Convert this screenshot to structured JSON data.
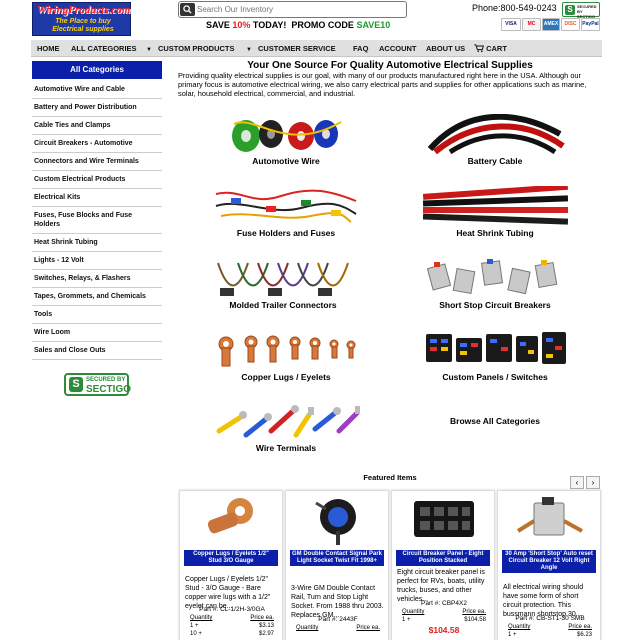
{
  "header": {
    "logo_title": "WiringProducts.com",
    "logo_tagline": "The Place to buy Electrical supplies",
    "search_placeholder": "Search Our Inventory",
    "promo": {
      "save": "SAVE",
      "percent": "10%",
      "today": "TODAY!",
      "code_label": "PROMO CODE",
      "code": "SAVE10"
    },
    "phone_label": "Phone:",
    "phone": "800-549-0243",
    "seal_small": "SECURED BY SECTIGO",
    "cards": [
      "VISA",
      "MC",
      "AMEX",
      "DISC",
      "PayPal"
    ]
  },
  "nav": {
    "items": [
      "HOME",
      "ALL CATEGORIES",
      "CUSTOM PRODUCTS",
      "CUSTOMER SERVICE",
      "FAQ",
      "ACCOUNT",
      "ABOUT US",
      "CART"
    ]
  },
  "sidebar": {
    "heading": "All Categories",
    "items": [
      "Automotive Wire and Cable",
      "Battery and Power Distribution",
      "Cable Ties and Clamps",
      "Circuit Breakers - Automotive",
      "Connectors and Wire Terminals",
      "Custom Electrical Products",
      "Electrical Kits",
      "Fuses, Fuse Blocks and Fuse Holders",
      "Heat Shrink Tubing",
      "Lights - 12 Volt",
      "Switches, Relays, & Flashers",
      "Tapes, Grommets, and Chemicals",
      "Tools",
      "Wire Loom",
      "Sales and Close Outs"
    ],
    "secured_top": "SECURED BY",
    "secured_brand": "SECTIGO"
  },
  "main": {
    "title": "Your One Source For Quality Automotive Electrical Supplies",
    "intro": "Providing quality electrical supplies is our goal, with many of our products manufactured right here in the USA. Although our primary focus is automotive electrical wiring, we also carry electrical parts and supplies for other applications such as marine, solar, household electrical, commercial, and industrial.",
    "categories": [
      "Automotive Wire",
      "Battery Cable",
      "Fuse Holders and Fuses",
      "Heat Shrink Tubing",
      "Molded Trailer Connectors",
      "Short Stop Circuit Breakers",
      "Copper Lugs / Eyelets",
      "Custom Panels / Switches",
      "Wire Terminals"
    ],
    "browse_all": "Browse All Categories"
  },
  "featured": {
    "heading": "Featured Items",
    "prev": "‹",
    "next": "›",
    "qty_label": "Quantity",
    "price_label": "Price ea.",
    "items": [
      {
        "title": "Copper Lugs / Eyelets 1/2\" Stud 3/O Gauge",
        "desc": "Copper Lugs / Eyelets 1/2\" Stud - 3/O Gauge - Bare copper wire lugs with a 1/2\" eyelet can be...",
        "part": "Part #: CL-1/2H-3/0GA",
        "rows": [
          [
            "1 +",
            "$3.13"
          ],
          [
            "10 +",
            "$2.97"
          ]
        ]
      },
      {
        "title": "GM Double Contact Signal Park Light Socket Twist Fit 1998+",
        "desc": "3-Wire GM Double Contact Rail, Turn and Stop Light Socket. From 1988 thru 2003. Replaces GM...",
        "part": "Part #: 2443F",
        "rows": [
          [
            "Quantity",
            "Price ea."
          ]
        ]
      },
      {
        "title": "Circuit Breaker Panel - Eight Position Stacked",
        "desc": "Eight circuit breaker panel is perfect for RVs, boats, utility trucks, buses, and other vehicles...",
        "part": "Part #: CBP4X2",
        "rows": [
          [
            "1 +",
            "$104.58"
          ]
        ],
        "price": "$104.58"
      },
      {
        "title": "30 Amp 'Short Stop' Auto reset Circuit Breaker 12 Volt Right Angle",
        "desc": "All electrical wiring should have some form of short circuit protection. This bussmann shortstop 30...",
        "part": "Part #: CB-ST1-30 SMB",
        "rows": [
          [
            "1 +",
            "$6.23"
          ]
        ]
      }
    ]
  }
}
